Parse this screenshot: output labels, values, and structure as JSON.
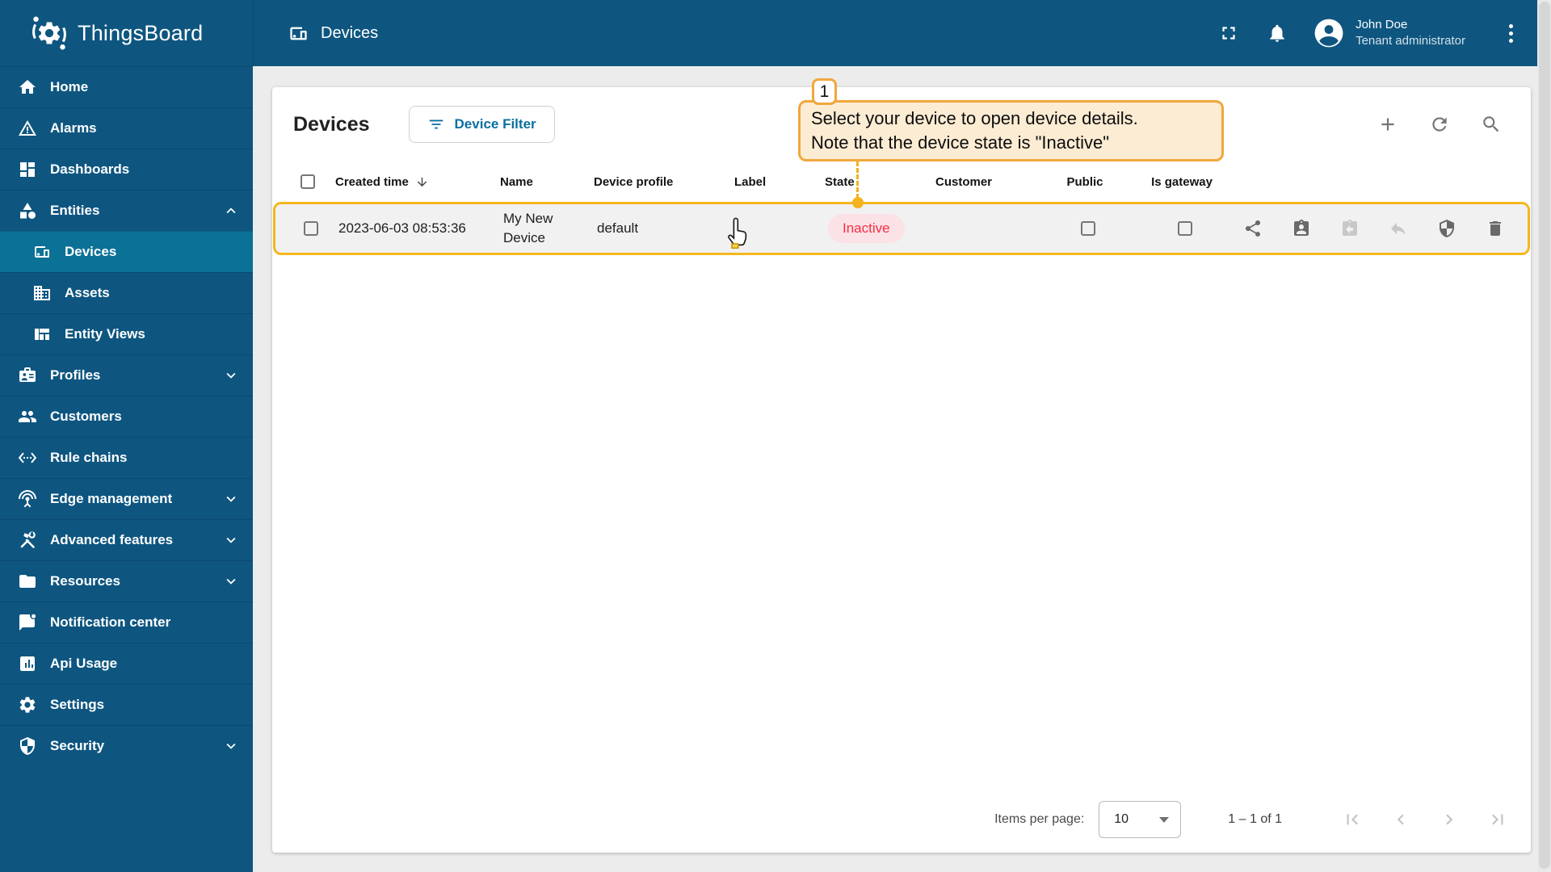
{
  "app": {
    "name": "ThingsBoard"
  },
  "topbar": {
    "title": "Devices",
    "user": {
      "name": "John Doe",
      "role": "Tenant administrator"
    }
  },
  "sidebar": {
    "items": [
      {
        "label": "Home"
      },
      {
        "label": "Alarms"
      },
      {
        "label": "Dashboards"
      },
      {
        "label": "Entities"
      },
      {
        "label": "Devices"
      },
      {
        "label": "Assets"
      },
      {
        "label": "Entity Views"
      },
      {
        "label": "Profiles"
      },
      {
        "label": "Customers"
      },
      {
        "label": "Rule chains"
      },
      {
        "label": "Edge management"
      },
      {
        "label": "Advanced features"
      },
      {
        "label": "Resources"
      },
      {
        "label": "Notification center"
      },
      {
        "label": "Api Usage"
      },
      {
        "label": "Settings"
      },
      {
        "label": "Security"
      }
    ]
  },
  "page": {
    "title": "Devices",
    "filter_button": "Device Filter"
  },
  "callout": {
    "step": "1",
    "line1": "Select your device to open device details.",
    "line2": "Note that the device state is \"Inactive\""
  },
  "table": {
    "columns": {
      "created": "Created time",
      "name": "Name",
      "profile": "Device profile",
      "label": "Label",
      "state": "State",
      "customer": "Customer",
      "public": "Public",
      "gateway": "Is gateway"
    },
    "rows": [
      {
        "created": "2023-06-03 08:53:36",
        "name": "My New Device",
        "profile": "default",
        "label": "",
        "state": "Inactive",
        "customer": "",
        "public": false,
        "gateway": false
      }
    ]
  },
  "pagination": {
    "items_per_page_label": "Items per page:",
    "page_size": "10",
    "range": "1 – 1 of 1"
  },
  "colors": {
    "brand": "#0e5680",
    "active_item": "#0c7197",
    "row_highlight_border": "#f3b71d",
    "callout_border": "#f0a73c",
    "callout_bg": "#fcecd3",
    "inactive_text": "#f52e44",
    "inactive_bg": "#fbe2e6",
    "filter_button_text": "#0a6fa0"
  }
}
